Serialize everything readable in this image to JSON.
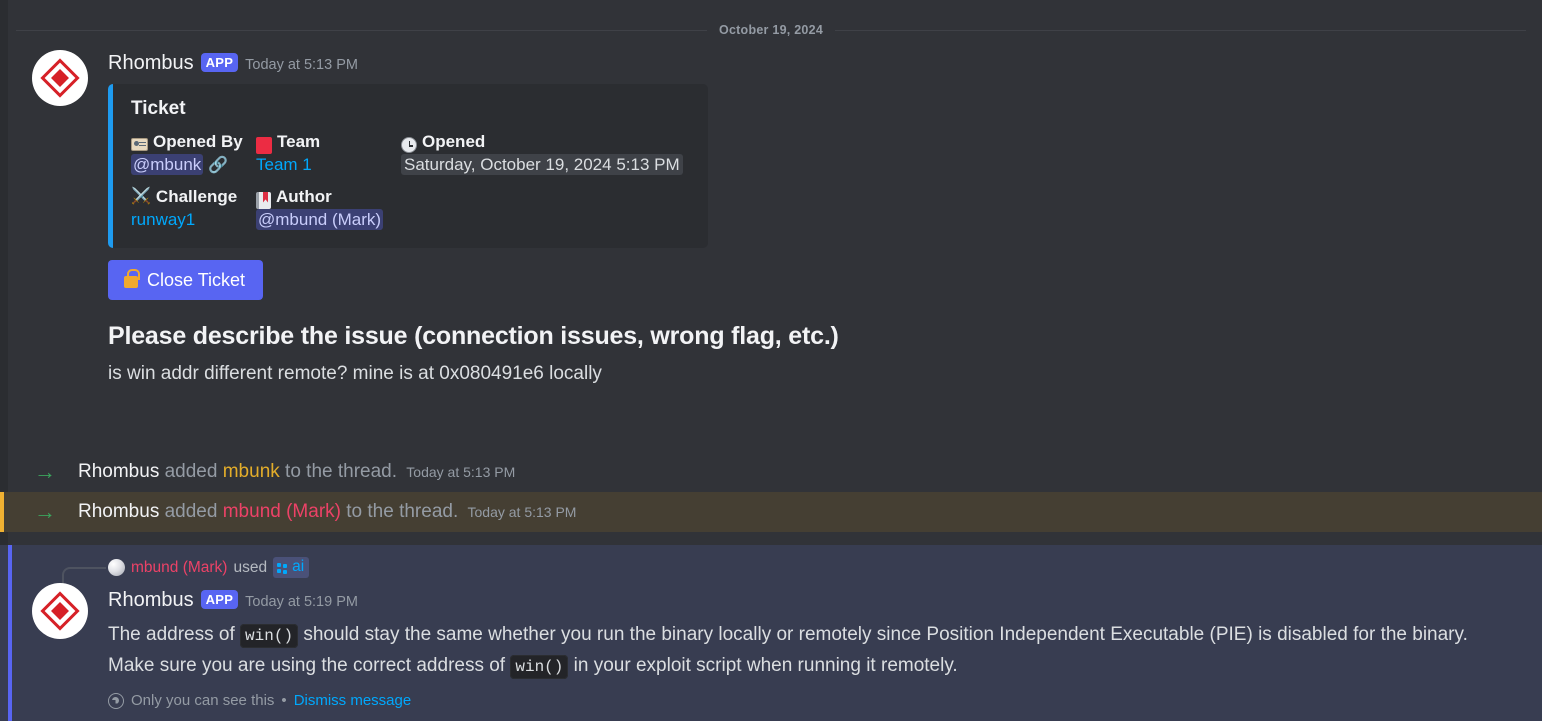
{
  "divider": {
    "date": "October 19, 2024"
  },
  "bot_message": {
    "author": "Rhombus",
    "app_tag": "APP",
    "timestamp": "Today at 5:13 PM",
    "embed": {
      "title": "Ticket",
      "fields": [
        {
          "name": "Opened By",
          "icon": "id-card-icon",
          "value": "@mbunk",
          "value_kind": "mention",
          "suffix_icon": "link-icon"
        },
        {
          "name": "Team",
          "icon": "red-square-icon",
          "value": "Team 1",
          "value_kind": "link"
        },
        {
          "name": "Opened",
          "icon": "clock-icon",
          "value": "Saturday, October 19, 2024 5:13 PM",
          "value_kind": "timestamp-chip"
        },
        {
          "name": "Challenge",
          "icon": "crossed-swords-icon",
          "value": "runway1",
          "value_kind": "link"
        },
        {
          "name": "Author",
          "icon": "notebook-icon",
          "value": "@mbund (Mark)",
          "value_kind": "mention"
        }
      ],
      "accent_color": "#1e9bf0"
    },
    "button": {
      "label": "Close Ticket",
      "icon": "lock-icon",
      "color": "#5865f2"
    },
    "prompt_heading": "Please describe the issue (connection issues, wrong flag, etc.)",
    "prompt_body": "is win addr different remote? mine is at 0x080491e6 locally"
  },
  "system_messages": [
    {
      "actor": "Rhombus",
      "verb": "added",
      "target": "mbunk",
      "target_color": "#e3ad2a",
      "tail": "to the thread.",
      "timestamp": "Today at 5:13 PM",
      "highlighted": false
    },
    {
      "actor": "Rhombus",
      "verb": "added",
      "target": "mbund (Mark)",
      "target_color": "#ec4267",
      "tail": "to the thread.",
      "timestamp": "Today at 5:13 PM",
      "highlighted": true
    }
  ],
  "ephemeral": {
    "used_by": "mbund (Mark)",
    "used_verb": "used",
    "command": "ai",
    "author": "Rhombus",
    "app_tag": "APP",
    "timestamp": "Today at 5:19 PM",
    "text_part_1": "The address of ",
    "code_1": "win()",
    "text_part_2": " should stay the same whether you run the binary locally or remotely since Position Independent Executable (PIE) is disabled for the binary. Make sure you are using the correct address of ",
    "code_2": "win()",
    "text_part_3": " in your exploit script when running it remotely.",
    "visibility_note": "Only you can see this",
    "separator": "•",
    "dismiss_label": "Dismiss message"
  }
}
